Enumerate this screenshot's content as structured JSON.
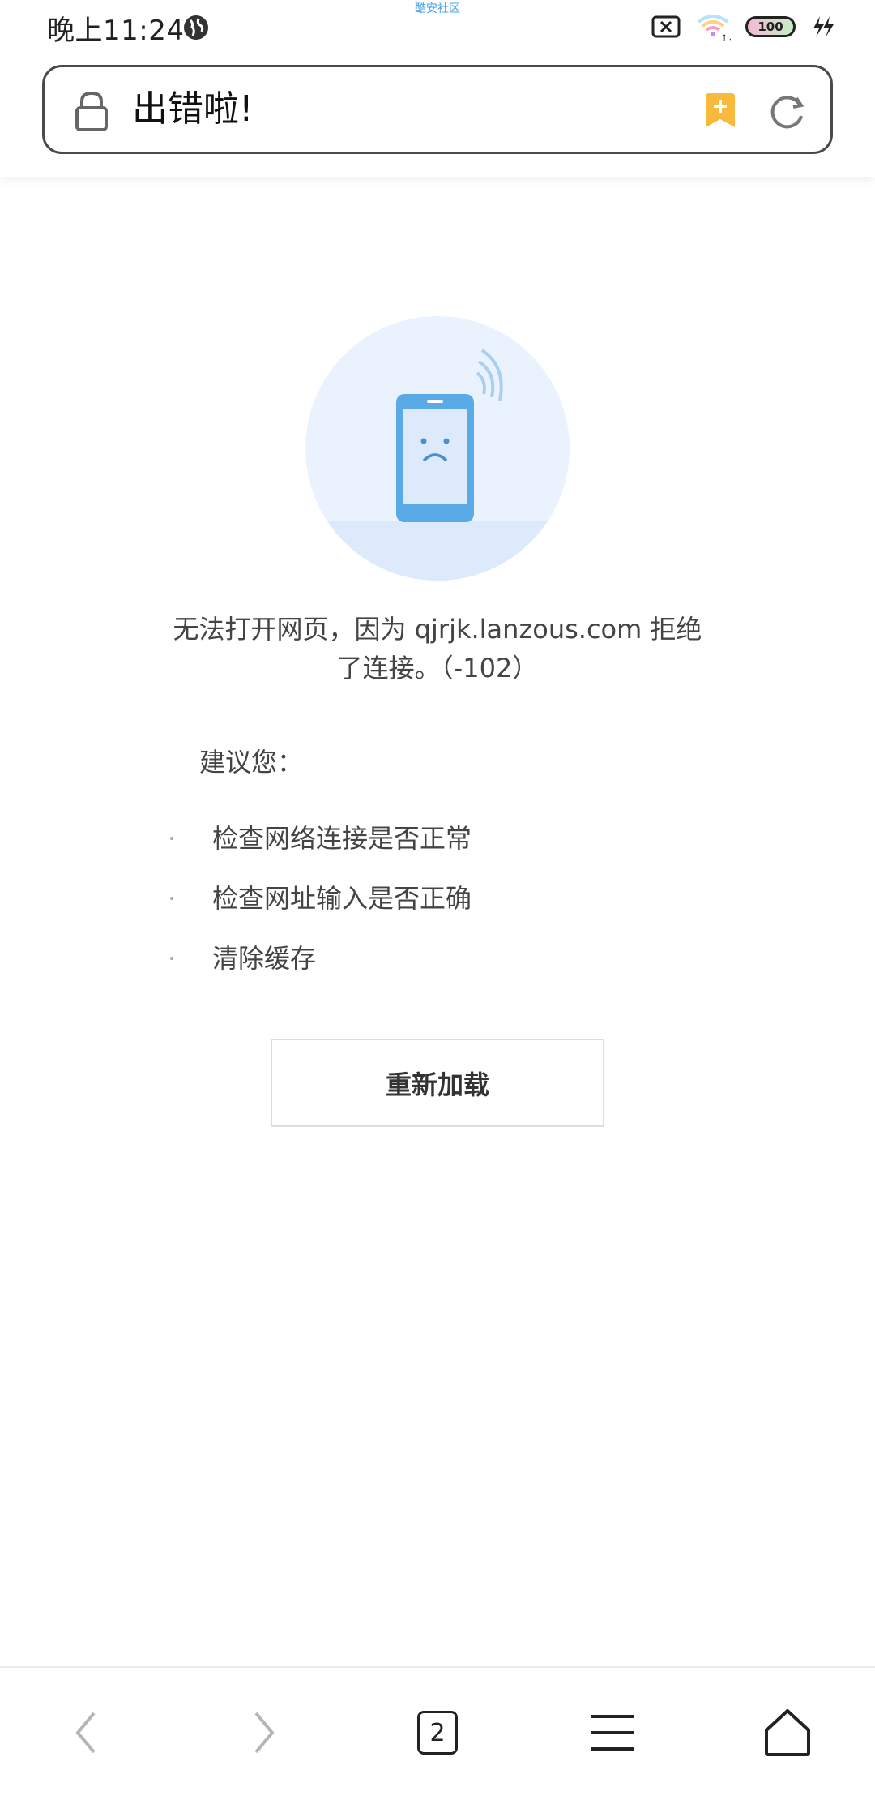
{
  "status_bar": {
    "time": "晚上11:24",
    "watermark": "酷安社区",
    "battery": "100"
  },
  "address_bar": {
    "title": "出错啦!"
  },
  "error": {
    "message": "无法打开网页，因为 qjrjk.lanzous.com 拒绝了连接。（-102）"
  },
  "suggestions": {
    "title": "建议您：",
    "items": [
      "检查网络连接是否正常",
      "检查网址输入是否正确",
      "清除缓存"
    ]
  },
  "reload_button": {
    "label": "重新加载"
  },
  "bottom_nav": {
    "tab_count": "2"
  },
  "colors": {
    "accent_blue": "#5aaae8",
    "bookmark_yellow": "#f8b93c",
    "illustration_bg": "#eaf3fd"
  }
}
